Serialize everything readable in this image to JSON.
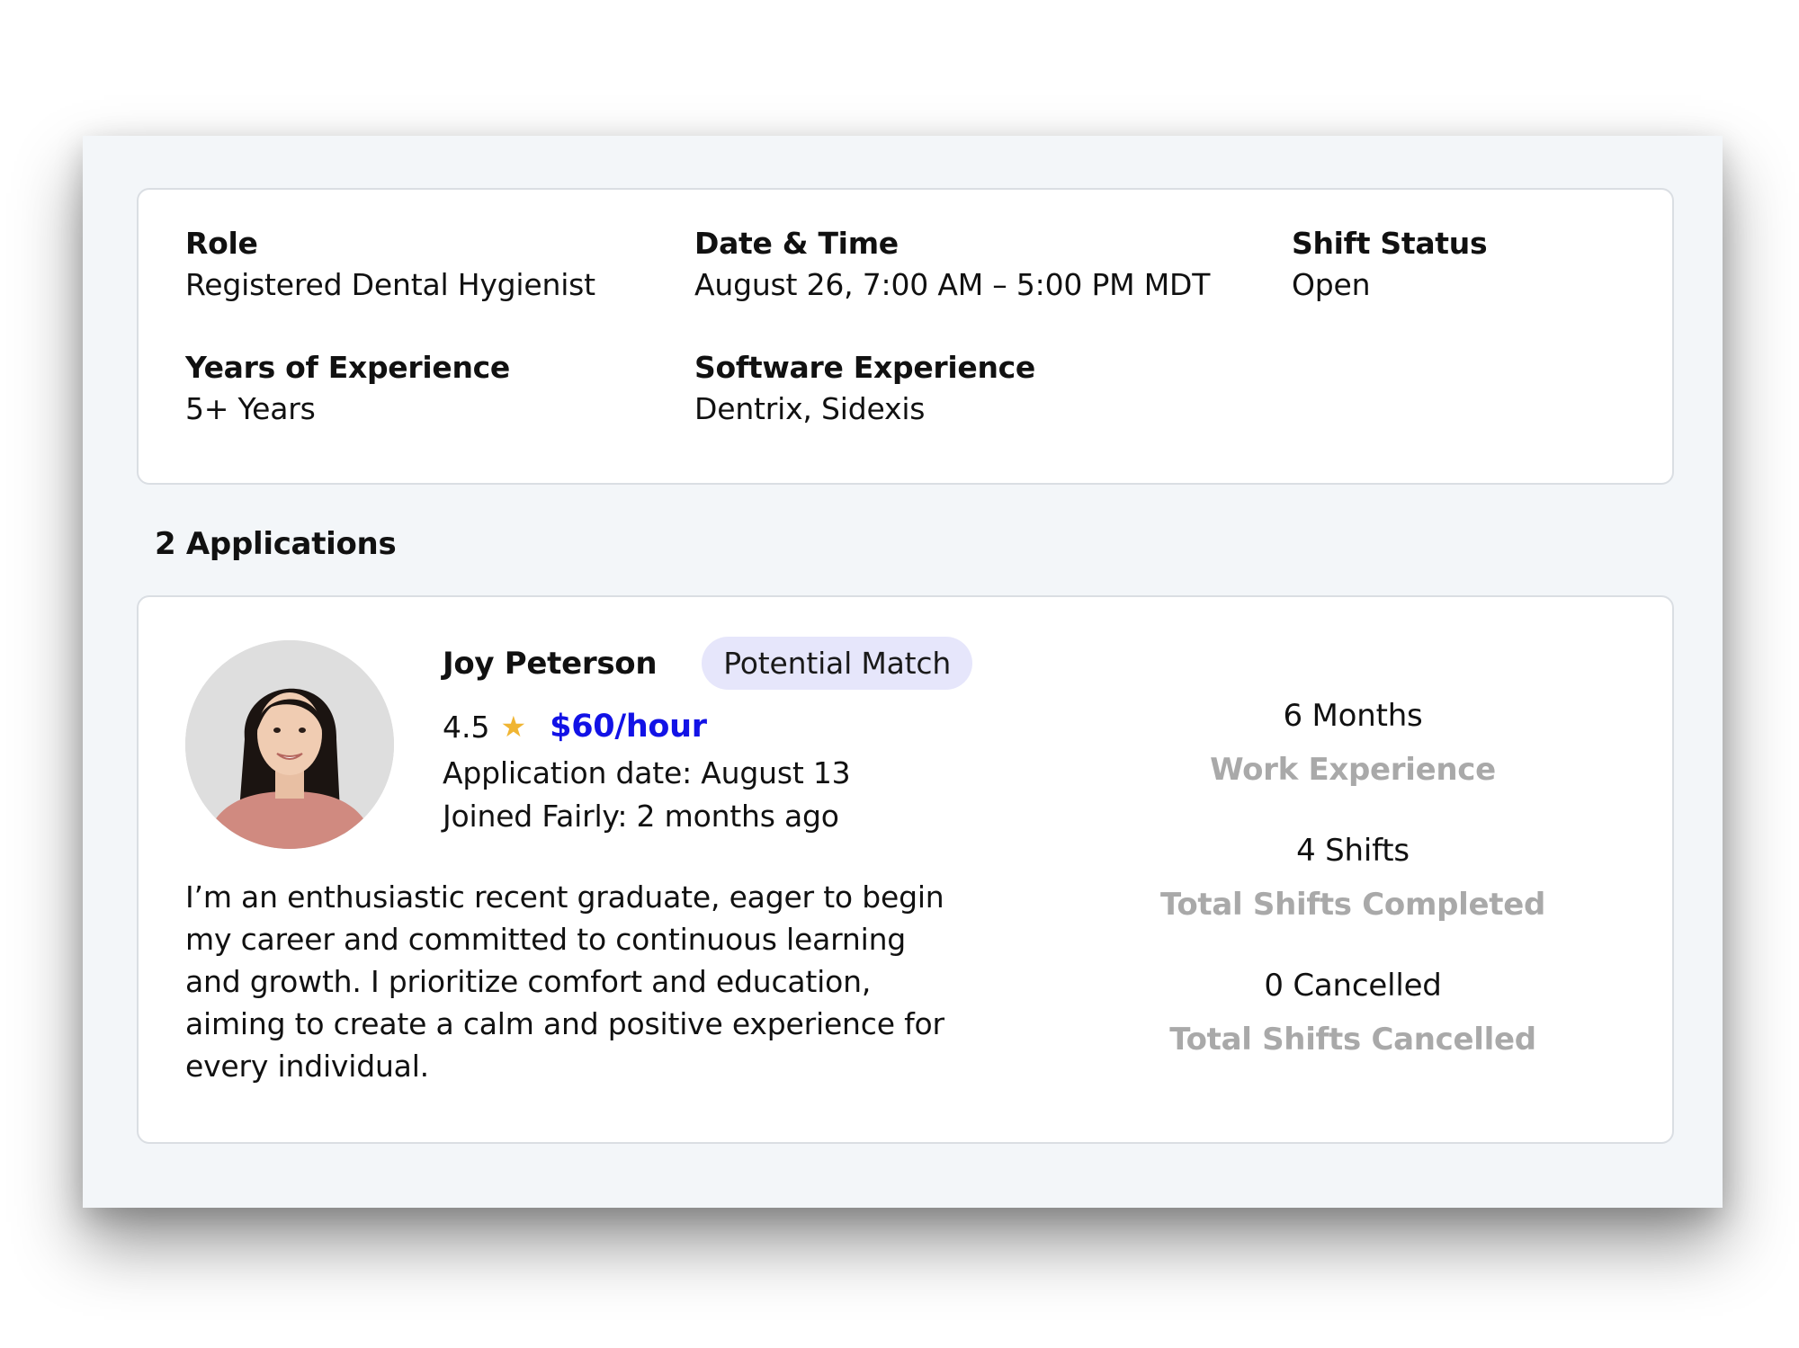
{
  "shift": {
    "role": {
      "label": "Role",
      "value": "Registered Dental Hygienist"
    },
    "date_time": {
      "label": "Date & Time",
      "value": "August 26, 7:00 AM – 5:00 PM MDT"
    },
    "status": {
      "label": "Shift Status",
      "value": "Open"
    },
    "years": {
      "label": "Years of Experience",
      "value": "5+ Years"
    },
    "software": {
      "label": "Software Experience",
      "value": "Dentrix, Sidexis"
    }
  },
  "applications": {
    "heading": "2 Applications",
    "items": [
      {
        "name": "Joy Peterson",
        "badge": "Potential Match",
        "rating": "4.5",
        "star_icon": "star-icon",
        "rate": "$60/hour",
        "application_date": "Application date: August 13",
        "joined": "Joined Fairly: 2 months ago",
        "bio": "I’m an enthusiastic recent graduate, eager to begin my career and committed to continuous learning and growth. I prioritize comfort and education, aiming to create a calm and positive experience for every individual.",
        "stats": [
          {
            "value": "6 Months",
            "label": "Work Experience"
          },
          {
            "value": "4 Shifts",
            "label": "Total Shifts Completed"
          },
          {
            "value": "0 Cancelled",
            "label": "Total Shifts Cancelled"
          }
        ]
      }
    ]
  },
  "colors": {
    "rate": "#1212e6",
    "star": "#f0b533",
    "badge_bg": "#e6e6fb",
    "stat_label": "#a9a9a9",
    "frame_bg": "#f3f6f9"
  }
}
